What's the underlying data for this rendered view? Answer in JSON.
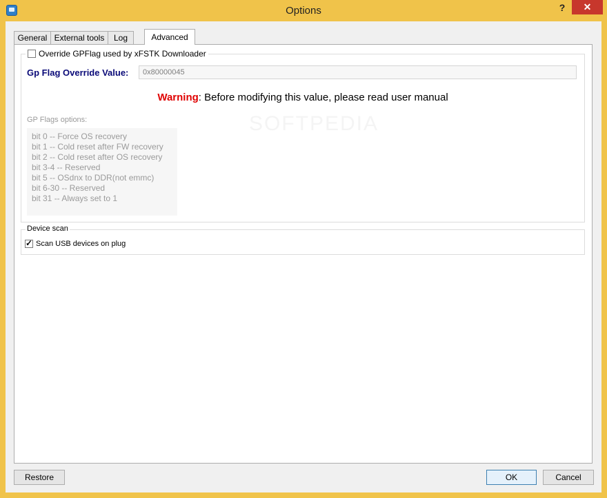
{
  "window": {
    "title": "Options",
    "help_label": "?",
    "close_label": "✕"
  },
  "tabs": [
    {
      "label": "General",
      "active": false
    },
    {
      "label": "External tools",
      "active": false
    },
    {
      "label": "Log",
      "active": false
    },
    {
      "label": "Advanced",
      "active": true
    }
  ],
  "gp_group": {
    "override_checkbox_label": "Override GPFlag used by xFSTK Downloader",
    "override_checked": false,
    "flag_label": "Gp Flag Override Value:",
    "flag_value": "0x80000045",
    "warning_word": "Warning",
    "warning_text": ": Before modifying this value, please read user manual",
    "options_label": "GP Flags options:",
    "bits": [
      "bit 0 -- Force OS recovery",
      "bit 1 -- Cold reset after FW recovery",
      "bit 2 -- Cold reset after OS recovery",
      "bit 3-4 -- Reserved",
      "bit 5 -- OSdnx to DDR(not emmc)",
      "bit 6-30 -- Reserved",
      "bit 31 -- Always set to 1"
    ]
  },
  "device_scan": {
    "title": "Device scan",
    "scan_usb_label": "Scan USB devices on plug",
    "scan_usb_checked": true
  },
  "buttons": {
    "restore": "Restore",
    "ok": "OK",
    "cancel": "Cancel"
  },
  "watermark": "SOFTPEDIA",
  "colors": {
    "title_bar": "#f0c34a",
    "close_button": "#c7372c",
    "warning": "#e00000",
    "flag_label": "#0a0a78"
  }
}
